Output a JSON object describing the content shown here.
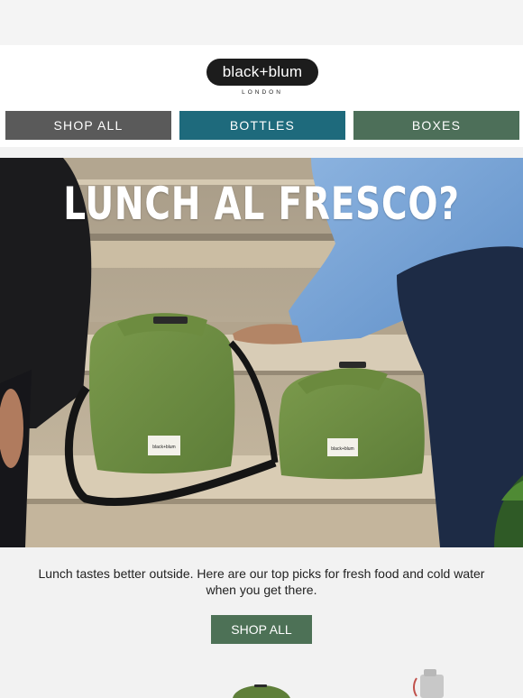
{
  "brand": {
    "name": "black+blum",
    "subtitle": "LONDON"
  },
  "nav": [
    {
      "label": "SHOP ALL",
      "color": "#5a5a5a"
    },
    {
      "label": "BOTTLES",
      "color": "#1e6a7c"
    },
    {
      "label": "BOXES",
      "color": "#4d6f59"
    }
  ],
  "hero": {
    "headline": "LUNCH AL FRESCO?",
    "bag_label": "black+blum"
  },
  "intro": {
    "text": "Lunch tastes better outside. Here are our top picks for fresh food and cold water when you get there."
  },
  "cta": {
    "label": "SHOP ALL",
    "color": "#4d7156"
  }
}
